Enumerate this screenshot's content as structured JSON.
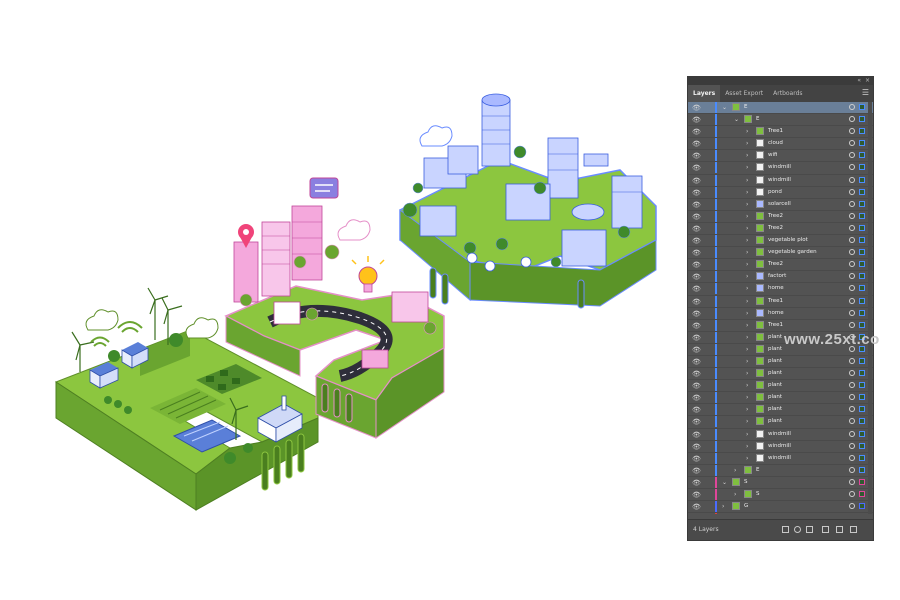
{
  "watermark": "www.25xt.co",
  "panel": {
    "tabs": [
      "Layers",
      "Asset Export",
      "Artboards"
    ],
    "menu_icon": "hamburger-menu-icon",
    "footer_count": "4 Layers",
    "footer_icons": [
      "collect-export-icon",
      "locate-object-icon",
      "make-clipping-mask-icon",
      "new-sublayer-icon",
      "new-layer-icon",
      "delete-layer-icon"
    ],
    "rows": [
      {
        "name": "E",
        "indent": 0,
        "expanded": true,
        "thumb": "green",
        "color": "#4a8cff",
        "selected": true
      },
      {
        "name": "E",
        "indent": 1,
        "expanded": true,
        "thumb": "green",
        "color": "#4a8cff"
      },
      {
        "name": "Tree1",
        "indent": 2,
        "expanded": false,
        "thumb": "green",
        "color": "#4a8cff"
      },
      {
        "name": "cloud",
        "indent": 2,
        "expanded": false,
        "thumb": "white",
        "color": "#4a8cff"
      },
      {
        "name": "wifi",
        "indent": 2,
        "expanded": false,
        "thumb": "white",
        "color": "#4a8cff"
      },
      {
        "name": "windmill",
        "indent": 2,
        "expanded": false,
        "thumb": "white",
        "color": "#4a8cff"
      },
      {
        "name": "windmill",
        "indent": 2,
        "expanded": false,
        "thumb": "white",
        "color": "#4a8cff"
      },
      {
        "name": "pond",
        "indent": 2,
        "expanded": false,
        "thumb": "white",
        "color": "#4a8cff"
      },
      {
        "name": "solarcell",
        "indent": 2,
        "expanded": false,
        "thumb": "blue",
        "color": "#4a8cff"
      },
      {
        "name": "Tree2",
        "indent": 2,
        "expanded": false,
        "thumb": "green",
        "color": "#4a8cff"
      },
      {
        "name": "Tree2",
        "indent": 2,
        "expanded": false,
        "thumb": "green",
        "color": "#4a8cff"
      },
      {
        "name": "vegetable plot",
        "indent": 2,
        "expanded": false,
        "thumb": "green",
        "color": "#4a8cff"
      },
      {
        "name": "vegetable garden",
        "indent": 2,
        "expanded": false,
        "thumb": "green",
        "color": "#4a8cff"
      },
      {
        "name": "Tree2",
        "indent": 2,
        "expanded": false,
        "thumb": "green",
        "color": "#4a8cff"
      },
      {
        "name": "factort",
        "indent": 2,
        "expanded": false,
        "thumb": "blue",
        "color": "#4a8cff"
      },
      {
        "name": "home",
        "indent": 2,
        "expanded": false,
        "thumb": "blue",
        "color": "#4a8cff"
      },
      {
        "name": "Tree1",
        "indent": 2,
        "expanded": false,
        "thumb": "green",
        "color": "#4a8cff"
      },
      {
        "name": "home",
        "indent": 2,
        "expanded": false,
        "thumb": "blue",
        "color": "#4a8cff"
      },
      {
        "name": "Tree1",
        "indent": 2,
        "expanded": false,
        "thumb": "green",
        "color": "#4a8cff"
      },
      {
        "name": "plant",
        "indent": 2,
        "expanded": false,
        "thumb": "green",
        "color": "#4a8cff"
      },
      {
        "name": "plant",
        "indent": 2,
        "expanded": false,
        "thumb": "green",
        "color": "#4a8cff"
      },
      {
        "name": "plant",
        "indent": 2,
        "expanded": false,
        "thumb": "green",
        "color": "#4a8cff"
      },
      {
        "name": "plant",
        "indent": 2,
        "expanded": false,
        "thumb": "green",
        "color": "#4a8cff"
      },
      {
        "name": "plant",
        "indent": 2,
        "expanded": false,
        "thumb": "green",
        "color": "#4a8cff"
      },
      {
        "name": "plant",
        "indent": 2,
        "expanded": false,
        "thumb": "green",
        "color": "#4a8cff"
      },
      {
        "name": "plant",
        "indent": 2,
        "expanded": false,
        "thumb": "green",
        "color": "#4a8cff"
      },
      {
        "name": "plant",
        "indent": 2,
        "expanded": false,
        "thumb": "green",
        "color": "#4a8cff"
      },
      {
        "name": "windmill",
        "indent": 2,
        "expanded": false,
        "thumb": "white",
        "color": "#4a8cff"
      },
      {
        "name": "windmill",
        "indent": 2,
        "expanded": false,
        "thumb": "white",
        "color": "#4a8cff"
      },
      {
        "name": "windmill",
        "indent": 2,
        "expanded": false,
        "thumb": "white",
        "color": "#4a8cff"
      },
      {
        "name": "E",
        "indent": 1,
        "expanded": false,
        "thumb": "green",
        "color": "#4a8cff"
      },
      {
        "name": "S",
        "indent": 0,
        "expanded": true,
        "thumb": "green",
        "color": "#e0469a"
      },
      {
        "name": "S",
        "indent": 1,
        "expanded": false,
        "thumb": "green",
        "color": "#e0469a"
      },
      {
        "name": "G",
        "indent": 0,
        "expanded": false,
        "thumb": "green",
        "color": "#4a6cff"
      },
      {
        "name": "BG",
        "indent": 0,
        "expanded": false,
        "thumb": "white",
        "color": "#e04040"
      }
    ]
  }
}
